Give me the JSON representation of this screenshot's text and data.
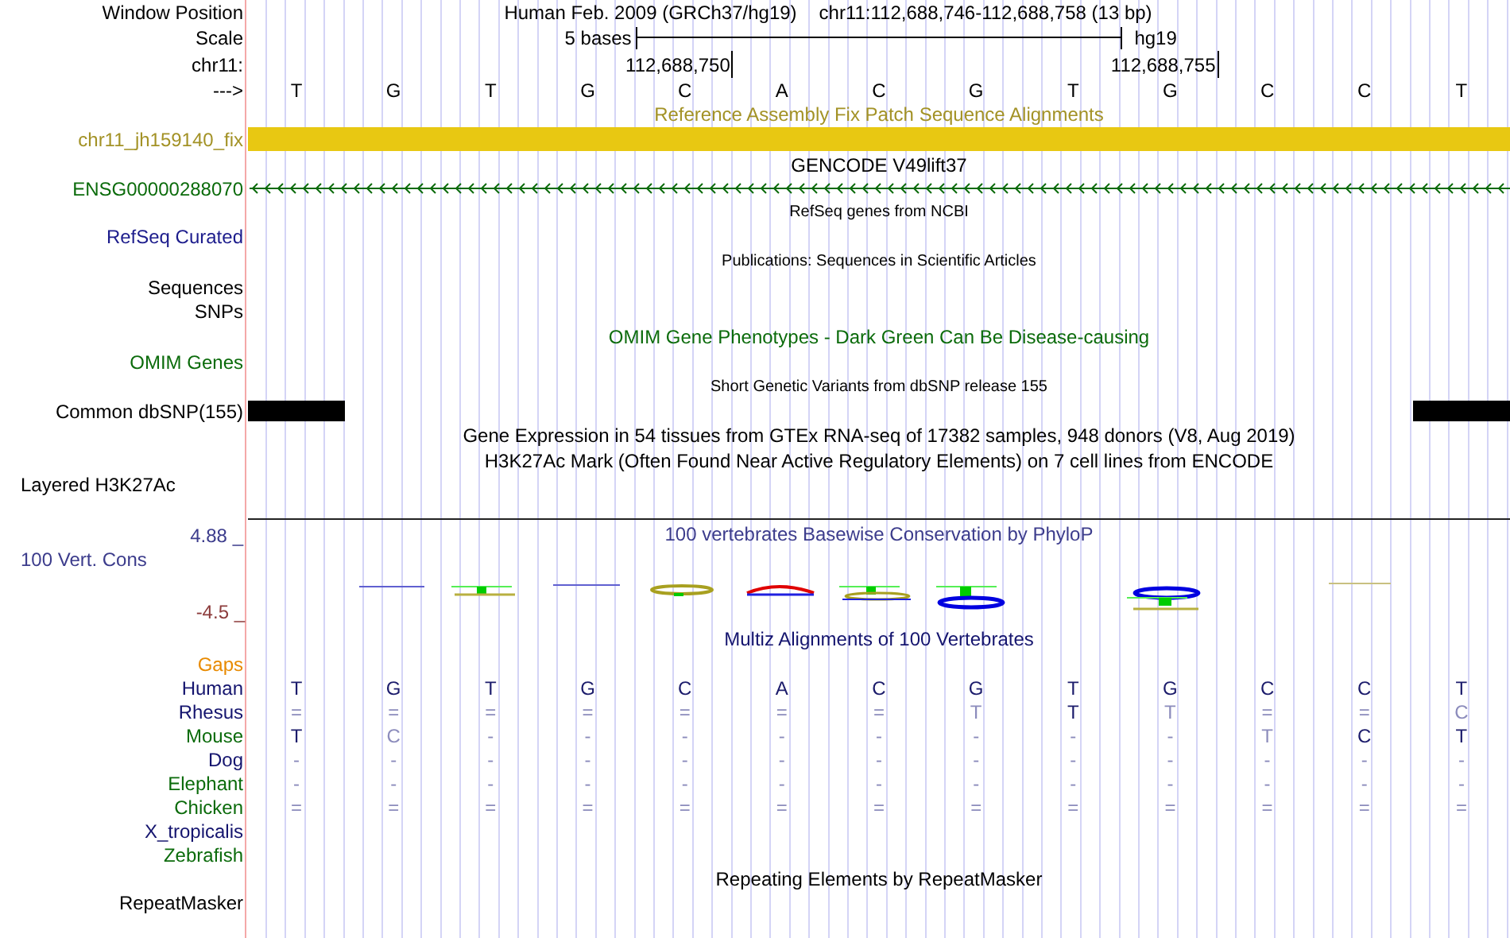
{
  "ruler": {
    "position_label": "Window Position",
    "assembly": "Human Feb. 2009 (GRCh37/hg19)",
    "range": "chr11:112,688,746-112,688,758 (13 bp)",
    "scale_label": "Scale",
    "scale_text": "5 bases",
    "scale_db": "hg19",
    "chrom_label": "chr11:",
    "ticks": [
      "112,688,750",
      "112,688,755"
    ],
    "strand_label": "--->",
    "bases": [
      "T",
      "G",
      "T",
      "G",
      "C",
      "A",
      "C",
      "G",
      "T",
      "G",
      "C",
      "C",
      "T"
    ]
  },
  "tracks": [
    {
      "kind": "bar",
      "title": {
        "text": "Reference Assembly Fix Patch Sequence Alignments",
        "color": "#a39226"
      },
      "labels": [
        {
          "text": "chr11_jh159140_fix",
          "color": "#a39226"
        }
      ]
    },
    {
      "kind": "gene",
      "title": {
        "text": "GENCODE V49lift37",
        "color": "#000000"
      },
      "labels": [
        {
          "text": "ENSG00000288070",
          "color": "#0b6b0b"
        }
      ]
    },
    {
      "kind": "ncbi",
      "title": {
        "text": "RefSeq genes from NCBI",
        "color": "#000000"
      },
      "labels": [
        {
          "text": "RefSeq Curated",
          "color": "#1c1c8c"
        }
      ]
    },
    {
      "kind": "pubs",
      "title": {
        "text": "Publications: Sequences in Scientific Articles",
        "color": "#000000"
      },
      "labels": [
        {
          "text": "Sequences",
          "color": "#000000"
        },
        {
          "text": "SNPs",
          "color": "#000000"
        }
      ]
    },
    {
      "kind": "omim",
      "title": {
        "text": "OMIM Gene Phenotypes - Dark Green Can Be Disease-causing",
        "color": "#0b6b0b"
      },
      "labels": [
        {
          "text": "OMIM Genes",
          "color": "#0b6b0b"
        }
      ]
    },
    {
      "kind": "snp",
      "title": {
        "text": "Short Genetic Variants from dbSNP release 155",
        "color": "#000000"
      },
      "labels": [
        {
          "text": "Common dbSNP(155)",
          "color": "#000000"
        }
      ]
    },
    {
      "kind": "gtex",
      "title": {
        "text": "Gene Expression in 54 tissues from GTEx RNA-seq of 17382 samples, 948 donors (V8, Aug 2019)",
        "color": "#000000"
      }
    },
    {
      "kind": "layered",
      "title": {
        "text": "H3K27Ac Mark (Often Found Near Active Regulatory Elements) on 7 cell lines from ENCODE",
        "color": "#000000"
      },
      "labels": [
        {
          "text": "Layered H3K27Ac",
          "color": "#000000"
        }
      ]
    },
    {
      "kind": "wiggle",
      "title": {
        "text": "100 vertebrates Basewise Conservation by PhyloP",
        "color": "#3c3c8c"
      },
      "labels": [
        {
          "text": "100 Vert. Cons",
          "color": "#3c3c8c"
        }
      ],
      "max": "4.88 _",
      "min": "-4.5 _"
    },
    {
      "kind": "multiz",
      "title": {
        "text": "Multiz Alignments of 100 Vertebrates",
        "color": "#14146e"
      },
      "species": [
        {
          "name": "Gaps",
          "color": "#e88a00"
        },
        {
          "name": "Human",
          "color": "#14146e",
          "bases": [
            {
              "base": "T",
              "faint": false
            },
            {
              "base": "G",
              "faint": false
            },
            {
              "base": "T",
              "faint": false
            },
            {
              "base": "G",
              "faint": false
            },
            {
              "base": "C",
              "faint": false
            },
            {
              "base": "A",
              "faint": false
            },
            {
              "base": "C",
              "faint": false
            },
            {
              "base": "G",
              "faint": false
            },
            {
              "base": "T",
              "faint": false
            },
            {
              "base": "G",
              "faint": false
            },
            {
              "base": "C",
              "faint": false
            },
            {
              "base": "C",
              "faint": false
            },
            {
              "base": "T",
              "faint": false
            }
          ]
        },
        {
          "name": "Rhesus",
          "color": "#14146e",
          "bases": [
            {
              "base": "=",
              "faint": true
            },
            {
              "base": "=",
              "faint": true
            },
            {
              "base": "=",
              "faint": true
            },
            {
              "base": "=",
              "faint": true
            },
            {
              "base": "=",
              "faint": true
            },
            {
              "base": "=",
              "faint": true
            },
            {
              "base": "=",
              "faint": true
            },
            {
              "base": "T",
              "faint": true
            },
            {
              "base": "T",
              "faint": false
            },
            {
              "base": "T",
              "faint": true
            },
            {
              "base": "=",
              "faint": true
            },
            {
              "base": "=",
              "faint": true
            },
            {
              "base": "C",
              "faint": true
            }
          ]
        },
        {
          "name": "Mouse",
          "color": "#0b6b0b",
          "bases": [
            {
              "base": "T",
              "faint": false
            },
            {
              "base": "C",
              "faint": true
            },
            {
              "base": "-",
              "faint": true
            },
            {
              "base": "-",
              "faint": true
            },
            {
              "base": "-",
              "faint": true
            },
            {
              "base": "-",
              "faint": true
            },
            {
              "base": "-",
              "faint": true
            },
            {
              "base": "-",
              "faint": true
            },
            {
              "base": "-",
              "faint": true
            },
            {
              "base": "-",
              "faint": true
            },
            {
              "base": "T",
              "faint": true
            },
            {
              "base": "C",
              "faint": false
            },
            {
              "base": "T",
              "faint": false
            }
          ]
        },
        {
          "name": "Dog",
          "color": "#14146e",
          "bases": [
            {
              "base": "-",
              "faint": true
            },
            {
              "base": "-",
              "faint": true
            },
            {
              "base": "-",
              "faint": true
            },
            {
              "base": "-",
              "faint": true
            },
            {
              "base": "-",
              "faint": true
            },
            {
              "base": "-",
              "faint": true
            },
            {
              "base": "-",
              "faint": true
            },
            {
              "base": "-",
              "faint": true
            },
            {
              "base": "-",
              "faint": true
            },
            {
              "base": "-",
              "faint": true
            },
            {
              "base": "-",
              "faint": true
            },
            {
              "base": "-",
              "faint": true
            },
            {
              "base": "-",
              "faint": true
            }
          ]
        },
        {
          "name": "Elephant",
          "color": "#0b6b0b",
          "bases": [
            {
              "base": "-",
              "faint": true
            },
            {
              "base": "-",
              "faint": true
            },
            {
              "base": "-",
              "faint": true
            },
            {
              "base": "-",
              "faint": true
            },
            {
              "base": "-",
              "faint": true
            },
            {
              "base": "-",
              "faint": true
            },
            {
              "base": "-",
              "faint": true
            },
            {
              "base": "-",
              "faint": true
            },
            {
              "base": "-",
              "faint": true
            },
            {
              "base": "-",
              "faint": true
            },
            {
              "base": "-",
              "faint": true
            },
            {
              "base": "-",
              "faint": true
            },
            {
              "base": "-",
              "faint": true
            }
          ]
        },
        {
          "name": "Chicken",
          "color": "#0b6b0b",
          "bases": [
            {
              "base": "=",
              "faint": true
            },
            {
              "base": "=",
              "faint": true
            },
            {
              "base": "=",
              "faint": true
            },
            {
              "base": "=",
              "faint": true
            },
            {
              "base": "=",
              "faint": true
            },
            {
              "base": "=",
              "faint": true
            },
            {
              "base": "=",
              "faint": true
            },
            {
              "base": "=",
              "faint": true
            },
            {
              "base": "=",
              "faint": true
            },
            {
              "base": "=",
              "faint": true
            },
            {
              "base": "=",
              "faint": true
            },
            {
              "base": "=",
              "faint": true
            },
            {
              "base": "=",
              "faint": true
            }
          ]
        },
        {
          "name": "X_tropicalis",
          "color": "#14146e"
        },
        {
          "name": "Zebrafish",
          "color": "#0b6b0b"
        }
      ]
    },
    {
      "kind": "repeats",
      "title": {
        "text": "Repeating Elements by RepeatMasker",
        "color": "#000000"
      },
      "labels": [
        {
          "text": "RepeatMasker",
          "color": "#000000"
        }
      ]
    }
  ]
}
